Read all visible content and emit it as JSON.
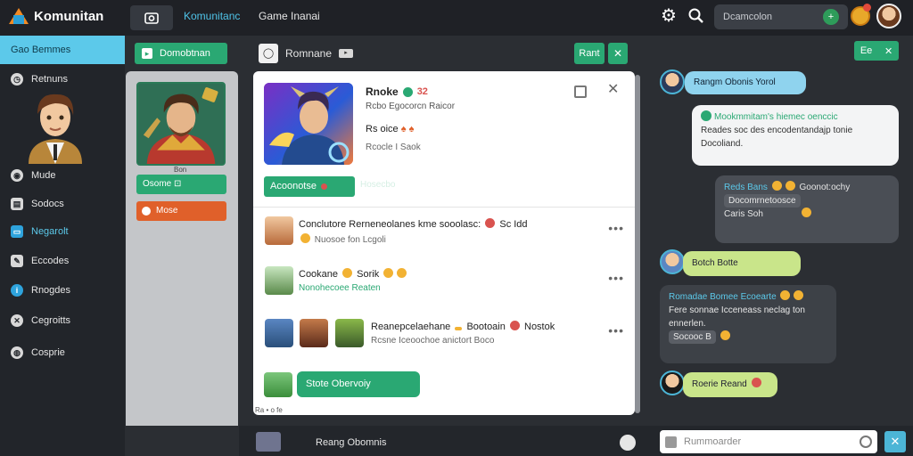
{
  "app": {
    "title": "Komunitan"
  },
  "topbar": {
    "tabs": [
      "Komunitanc",
      "Game Inanai"
    ],
    "search_value": "Dcamcolon",
    "search_badge": "+"
  },
  "sidebar": {
    "active": "Gao Bemmes",
    "items": [
      "Retnuns",
      "Mude",
      "Sodocs",
      "Negarolt",
      "Eccodes",
      "Rnogdes",
      "Cegroitts",
      "Cosprie"
    ]
  },
  "col2": {
    "header": "Domobtnan",
    "hero_caption": "Bon",
    "green_button": "Osome",
    "green_button_icon": "⊡",
    "orange_button": "Mose"
  },
  "main": {
    "header": "Romnane",
    "header_btn": "Rant",
    "header_btn2": "✕",
    "featured": {
      "title": "Rnoke",
      "title_badge": "32",
      "subtitle": "Rcbo Egocorcn Raicor",
      "line": "Rs oice",
      "line2": "Rcocle I Saok",
      "button": "Acoonotse",
      "faint": "Hosecbo"
    },
    "rows": [
      {
        "line1": "Conclutore Rerneneolanes kme sooolasc:",
        "line1_end": "Sc Idd",
        "line2": "Nuosoe fon Lcgoli"
      },
      {
        "line1": "Cookane",
        "line1_mid": "Sorik",
        "line2": "Nonohecoee Reaten"
      },
      {
        "line1": "Reanepcelaehane",
        "line1_mid": "Bootoain",
        "line1_end": "Nostok",
        "line2": "Rcsne Iceoochoe anictort Boco"
      }
    ],
    "more": "•••",
    "cta": "Stote Obervoiy",
    "footer": "Ra • o fe"
  },
  "bottombar": {
    "title": "Reang Obomnis",
    "input_placeholder": "Rummoarder",
    "send": "✕"
  },
  "chat": {
    "header_btn": "Ee",
    "header_btn2": "✕",
    "msgs": {
      "m1": "Rangm Obonis Yorol",
      "m2_teal": "Mookmmitam's hiemec oenccic",
      "m2_rest": "Reades soc des encodentandajp tonie Docoliand.",
      "m3_name": "Reds Bans",
      "m3_rest": "Goonot:ochy",
      "m3_line2": "Docomrnetoosce",
      "m3_line3": "Caris Soh",
      "m4": "Botch Botte",
      "m5_teal": "Romadae Bomee Ecoearte",
      "m5_rest": "Fere sonnae Icceneass neclag ton ennerlen.",
      "m5_chip": "Socooc B",
      "m6": "Roerie Reand"
    }
  },
  "colors": {
    "accent": "#2aa873",
    "highlight": "#5cc9ea",
    "orange": "#e0602a",
    "background": "#2b2e33"
  }
}
